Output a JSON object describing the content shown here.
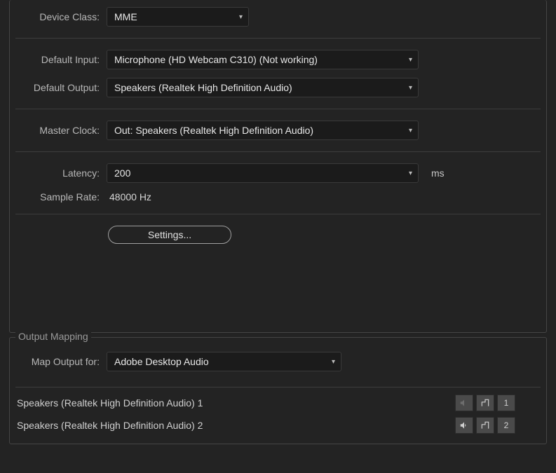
{
  "main": {
    "device_class_label": "Device Class:",
    "device_class_value": "MME",
    "default_input_label": "Default Input:",
    "default_input_value": "Microphone (HD Webcam C310) (Not working)",
    "default_output_label": "Default Output:",
    "default_output_value": "Speakers (Realtek High Definition Audio)",
    "master_clock_label": "Master Clock:",
    "master_clock_value": "Out: Speakers (Realtek High Definition Audio)",
    "latency_label": "Latency:",
    "latency_value": "200",
    "latency_unit": "ms",
    "sample_rate_label": "Sample Rate:",
    "sample_rate_value": "48000 Hz",
    "settings_button": "Settings..."
  },
  "output_mapping": {
    "legend": "Output Mapping",
    "map_output_for_label": "Map Output for:",
    "map_output_for_value": "Adobe Desktop Audio",
    "rows": [
      {
        "label": "Speakers (Realtek High Definition Audio) 1",
        "channel": "1",
        "muted": true
      },
      {
        "label": "Speakers (Realtek High Definition Audio) 2",
        "channel": "2",
        "muted": false
      }
    ]
  }
}
